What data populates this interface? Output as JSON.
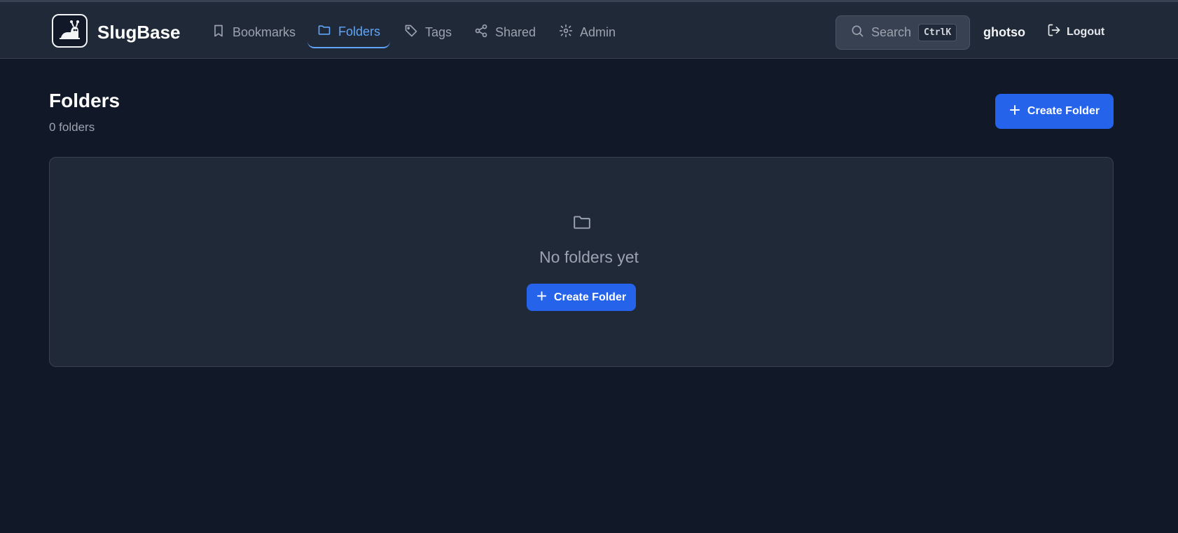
{
  "app": {
    "brand": "SlugBase"
  },
  "nav": {
    "items": [
      {
        "label": "Bookmarks",
        "icon": "bookmark-icon",
        "active": false
      },
      {
        "label": "Folders",
        "icon": "folder-icon",
        "active": true
      },
      {
        "label": "Tags",
        "icon": "tag-icon",
        "active": false
      },
      {
        "label": "Shared",
        "icon": "share-icon",
        "active": false
      },
      {
        "label": "Admin",
        "icon": "gear-icon",
        "active": false
      }
    ]
  },
  "search": {
    "label": "Search",
    "shortcut": "CtrlK"
  },
  "user": {
    "name": "ghotso",
    "logout_label": "Logout"
  },
  "page": {
    "title": "Folders",
    "subtitle": "0 folders",
    "create_button": "Create Folder"
  },
  "empty_state": {
    "message": "No folders yet",
    "button": "Create Folder",
    "icon": "folder-icon"
  },
  "colors": {
    "background": "#111827",
    "surface": "#1f2937",
    "accent": "#2563eb",
    "active_nav": "#60a5fa"
  }
}
